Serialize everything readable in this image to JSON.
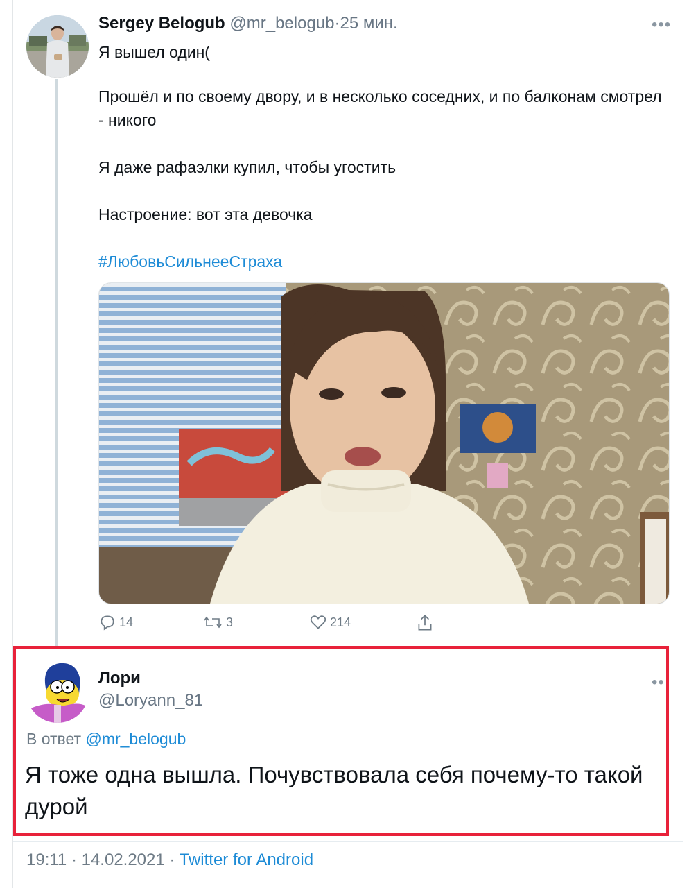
{
  "tweet": {
    "author_name": "Sergey Belogub",
    "author_handle": "@mr_belogub",
    "separator": "·",
    "time_ago": "25 мин.",
    "paragraphs": [
      "Я вышел один(",
      "Прошёл и по своему двору, и в несколько соседних, и по балконам смотрел - никого",
      "Я даже рафаэлки купил, чтобы угостить",
      "Настроение: вот эта девочка"
    ],
    "hashtag": "#ЛюбовьСильнееСтраха",
    "stats": {
      "replies": "14",
      "retweets": "3",
      "likes": "214"
    },
    "icons": [
      "reply-icon",
      "retweet-icon",
      "like-icon",
      "share-icon",
      "more-icon"
    ]
  },
  "reply": {
    "author_name": "Лори",
    "author_handle": "@Loryann_81",
    "reply_to_prefix": "В ответ",
    "reply_to_handle": "@mr_belogub",
    "text": "Я тоже одна вышла. Почувствовала себя почему-то такой дурой",
    "timestamp": "19:11 · 14.02.2021 ·",
    "source": "Twitter for Android"
  },
  "colors": {
    "link": "#1d8bd6",
    "muted": "#687684",
    "highlight_border": "#e8223a",
    "thread_line": "#cfd9de"
  }
}
